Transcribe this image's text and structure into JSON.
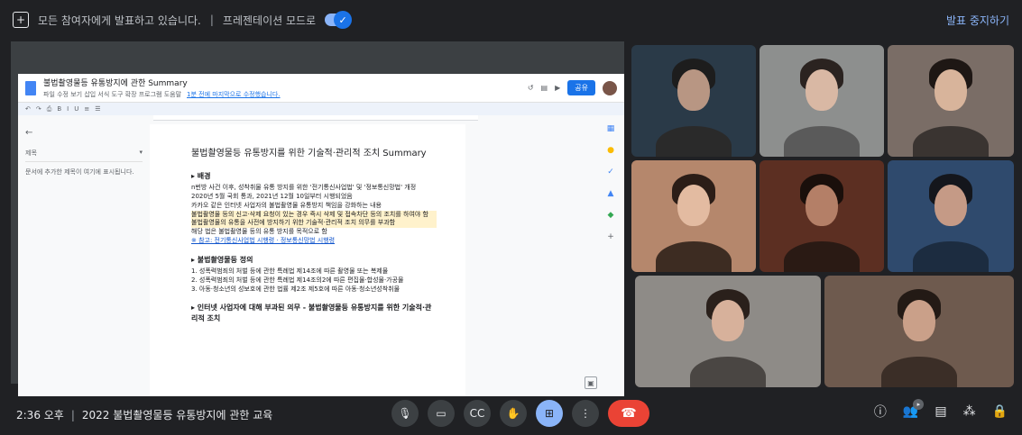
{
  "topbar": {
    "presenting_text": "모든 참여자에게 발표하고 있습니다.",
    "separator": "|",
    "presentation_mode": "프레젠테이션 모드로",
    "stop_label": "발표 중지하기"
  },
  "doc": {
    "title": "불법촬영물등 유통방지에 관한 Summary",
    "menu": "파일 수정 보기 삽입 서식 도구 확장 프로그램 도움말",
    "last_edit": "1분 전에 마지막으로 수정했습니다.",
    "share_label": "공유",
    "outline_title": "제목",
    "outline_hint": "문서에 추가한 제목이 여기에 표시됩니다.",
    "heading": "불법촬영물등 유통방지를 위한 기술적·관리적 조치 Summary",
    "sections": [
      {
        "title": "▸ 배경",
        "lines": [
          "n번방 사건 이후, 성착취물 유통 방지를 위한 '전기통신사업법' 및 '정보통신망법' 개정",
          "2020년 5월 국회 통과, 2021년 12월 10일부터 시행되었음",
          "카카오 같은 인터넷 사업자의 불법촬영물 유통방지 책임을 강화하는 내용",
          "불법촬영물 등의 신고·삭제 요청이 있는 경우 즉시 삭제 및 접속차단 등의 조치를 하여야 함",
          "불법촬영물의 유통을 사전에 방지하기 위한 기술적·관리적 조치 의무를 부과함",
          "해당 법은 불법촬영물 등의 유통 방지를 목적으로 함"
        ],
        "links": "※ 참고: 전기통신사업법 시행령 · 정보통신망법 시행령"
      },
      {
        "title": "▸ 불법촬영물등 정의",
        "lines": [
          "1. 성폭력범죄의 처벌 등에 관한 특례법 제14조에 따른 촬영물 또는 복제물",
          "2. 성폭력범죄의 처벌 등에 관한 특례법 제14조의2에 따른 편집물·합성물·가공물",
          "3. 아동·청소년의 성보호에 관한 법률 제2조 제5호에 따른 아동·청소년성착취물"
        ]
      },
      {
        "title": "▸ 인터넷 사업자에 대해 부과된 의무 - 불법촬영물등 유통방지를 위한 기술적·관리적 조치"
      }
    ]
  },
  "meeting": {
    "time": "2:36 오후",
    "separator": "|",
    "name": "2022 불법촬영물등 유통방지에 관한 교육"
  },
  "colors": {
    "background": "#202124",
    "accent": "#8ab4f8",
    "end_call": "#ea4335"
  }
}
